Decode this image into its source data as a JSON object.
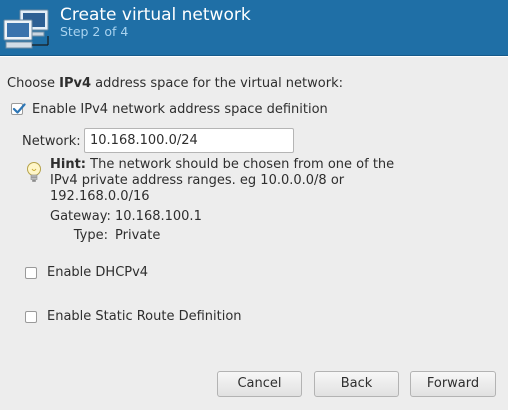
{
  "header": {
    "title": "Create virtual network",
    "subtitle": "Step 2 of 4",
    "icon": "network-computers-icon"
  },
  "main": {
    "prompt_prefix": "Choose ",
    "prompt_bold": "IPv4",
    "prompt_suffix": " address space for the virtual network:",
    "enable_ipv4": {
      "label": "Enable IPv4 network address space definition",
      "checked": true
    },
    "network": {
      "label": "Network:",
      "value": "10.168.100.0/24"
    },
    "hint": {
      "bold": "Hint:",
      "text": " The network should be chosen from one of the IPv4 private address ranges. eg 10.0.0.0/8 or 192.168.0.0/16"
    },
    "gateway": {
      "label": "Gateway:",
      "value": "10.168.100.1"
    },
    "type": {
      "label": "Type:",
      "value": "Private"
    },
    "enable_dhcp": {
      "label": "Enable DHCPv4",
      "checked": false
    },
    "enable_static_route": {
      "label": "Enable Static Route Definition",
      "checked": false
    }
  },
  "buttons": {
    "cancel": "Cancel",
    "back": "Back",
    "forward": "Forward"
  },
  "colors": {
    "banner": "#1f6fa6",
    "subtitle": "#a9d3ef",
    "body_bg": "#ededed",
    "check_accent": "#2d76b5"
  }
}
